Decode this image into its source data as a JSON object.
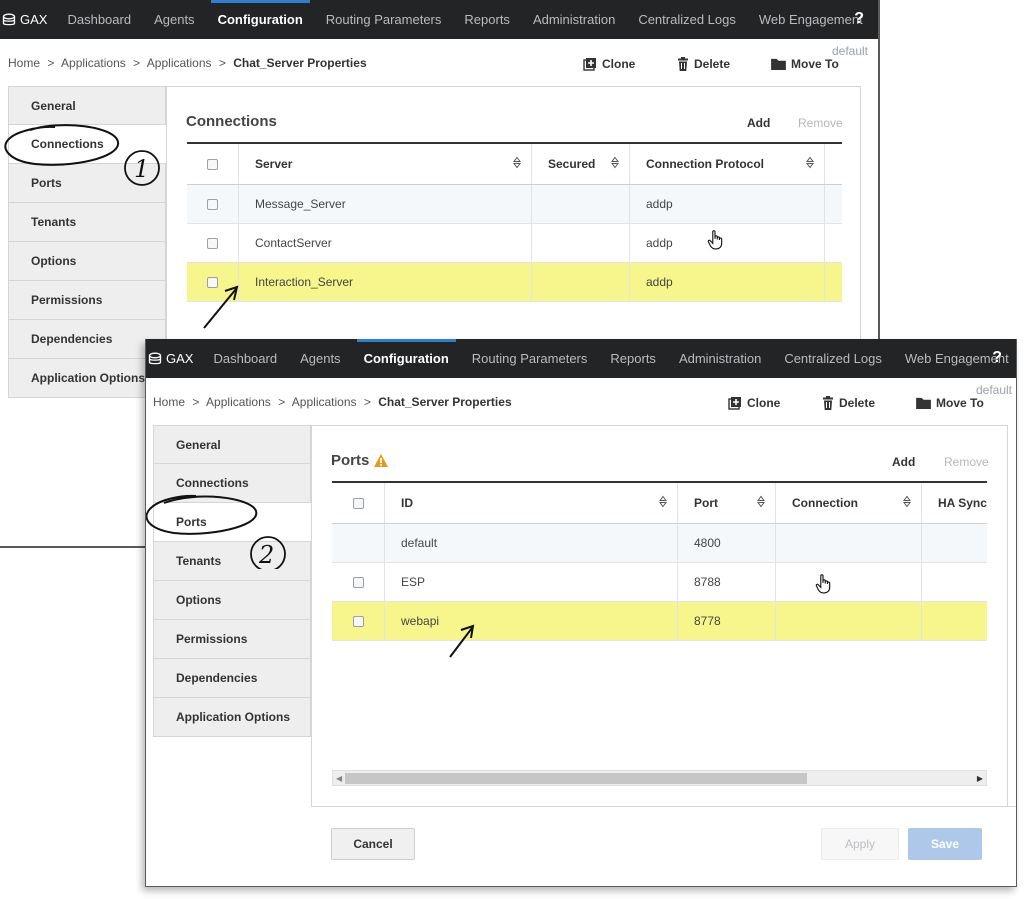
{
  "colors": {
    "nav_bg": "#222426",
    "active_accent": "#2d7fd1",
    "highlight_row": "#f6f68c",
    "save_button": "#aec8ea",
    "warning": "#e39b1e"
  },
  "nav": {
    "brand": "GAX",
    "items": [
      "Dashboard",
      "Agents",
      "Configuration",
      "Routing Parameters",
      "Reports",
      "Administration",
      "Centralized Logs",
      "Web Engagement"
    ],
    "active": "Configuration",
    "help": "?"
  },
  "breadcrumb": {
    "items": [
      "Home",
      ">",
      "Applications",
      ">",
      "Applications",
      ">"
    ],
    "current": "Chat_Server Properties"
  },
  "context": "default",
  "toolbar": {
    "clone": "Clone",
    "delete": "Delete",
    "move_to": "Move To"
  },
  "sidebar": {
    "items": [
      "General",
      "Connections",
      "Ports",
      "Tenants",
      "Options",
      "Permissions",
      "Dependencies",
      "Application Options"
    ]
  },
  "connections": {
    "title": "Connections",
    "add": "Add",
    "remove": "Remove",
    "columns": [
      "Server",
      "Secured",
      "Connection Protocol"
    ],
    "rows": [
      {
        "server": "Message_Server",
        "secured": "",
        "protocol": "addp"
      },
      {
        "server": "ContactServer",
        "secured": "",
        "protocol": "addp"
      },
      {
        "server": "Interaction_Server",
        "secured": "",
        "protocol": "addp"
      }
    ]
  },
  "ports": {
    "title": "Ports",
    "warning_icon": "warning-triangle-icon",
    "add": "Add",
    "remove": "Remove",
    "columns": [
      "ID",
      "Port",
      "Connection",
      "HA Sync"
    ],
    "rows": [
      {
        "id": "default",
        "port": "4800",
        "connection": "",
        "hasync": ""
      },
      {
        "id": "ESP",
        "port": "8788",
        "connection": "",
        "hasync": ""
      },
      {
        "id": "webapi",
        "port": "8778",
        "connection": "",
        "hasync": ""
      }
    ]
  },
  "footer": {
    "cancel": "Cancel",
    "apply": "Apply",
    "save": "Save"
  },
  "annotations": {
    "step1": "1",
    "step2": "2"
  }
}
